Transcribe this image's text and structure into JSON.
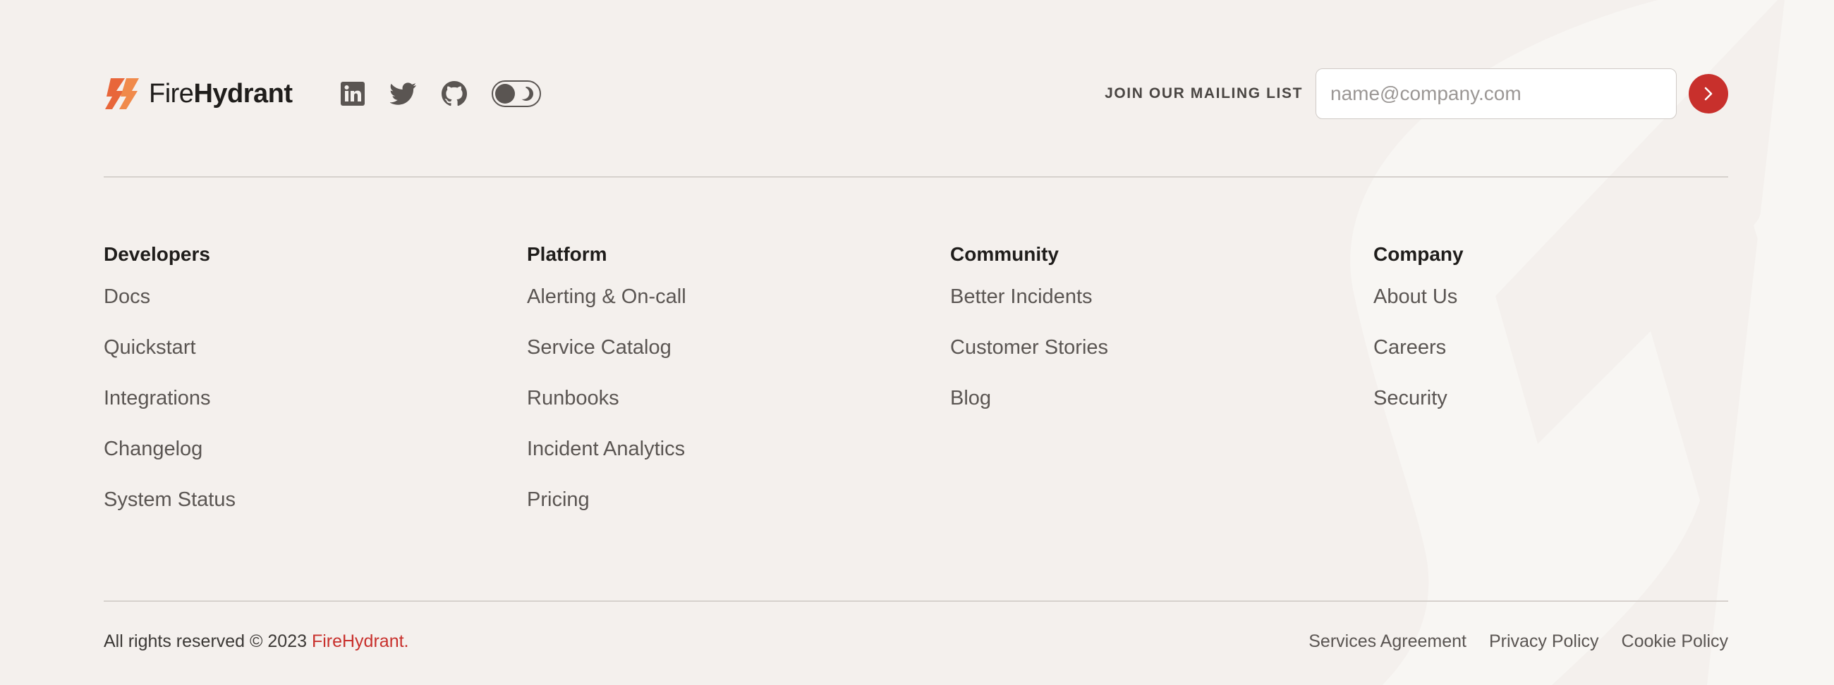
{
  "brand": {
    "name_light": "Fire",
    "name_bold": "Hydrant",
    "accent_color": "#c8302c",
    "logo_color": "#e8663a"
  },
  "socials": [
    {
      "icon": "linkedin-icon"
    },
    {
      "icon": "twitter-icon"
    },
    {
      "icon": "github-icon"
    }
  ],
  "theme_toggle": {
    "icon": "moon-icon"
  },
  "mailing": {
    "label": "JOIN OUR MAILING LIST",
    "placeholder": "name@company.com",
    "submit_icon": "chevron-right-icon"
  },
  "columns": [
    {
      "title": "Developers",
      "links": [
        "Docs",
        "Quickstart",
        "Integrations",
        "Changelog",
        "System Status"
      ]
    },
    {
      "title": "Platform",
      "links": [
        "Alerting & On-call",
        "Service Catalog",
        "Runbooks",
        "Incident Analytics",
        "Pricing"
      ]
    },
    {
      "title": "Community",
      "links": [
        "Better Incidents",
        "Customer Stories",
        "Blog"
      ]
    },
    {
      "title": "Company",
      "links": [
        "About Us",
        "Careers",
        "Security"
      ]
    }
  ],
  "footer": {
    "copyright": "All rights reserved © 2023 ",
    "brand_link": "FireHydrant.",
    "legal": [
      "Services Agreement",
      "Privacy Policy",
      "Cookie Policy"
    ]
  }
}
